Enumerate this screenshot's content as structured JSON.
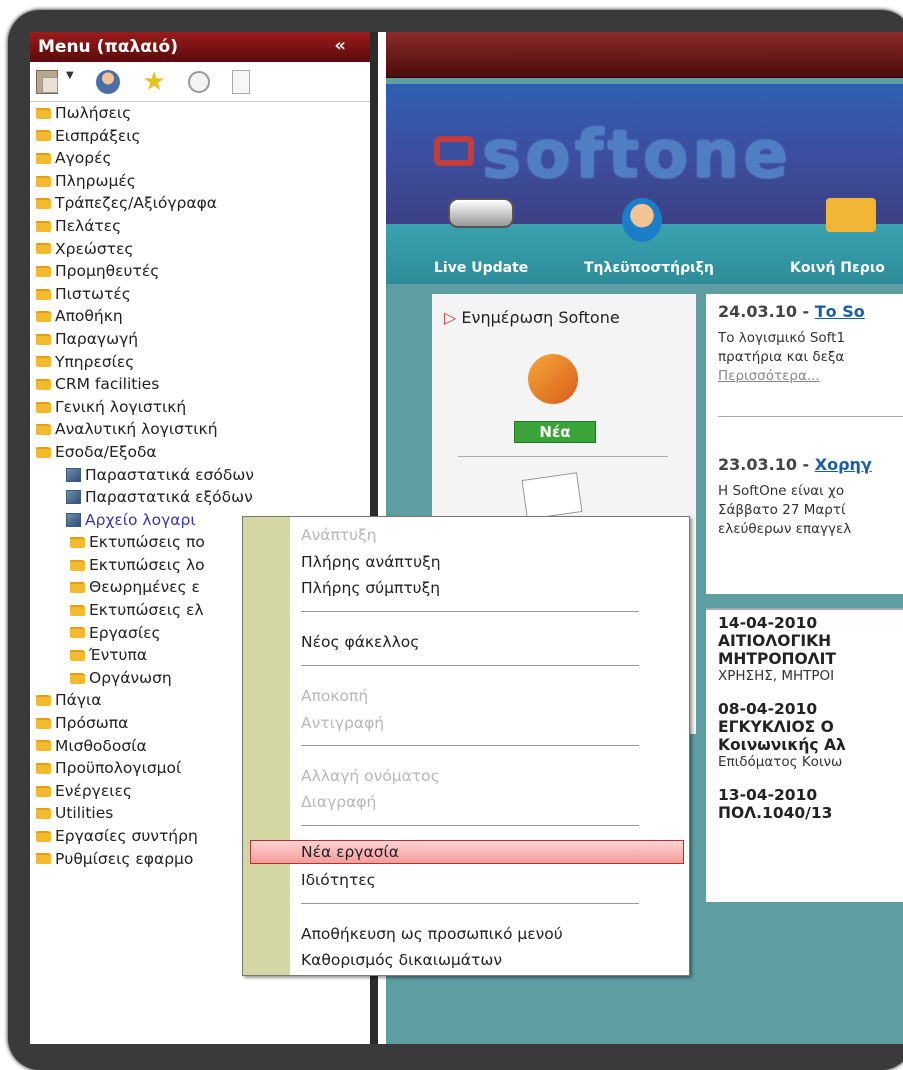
{
  "menu": {
    "title": "Menu (παλαιό)",
    "collapse_icon": "double-chevron-left",
    "tree": [
      {
        "label": "Πωλήσεις",
        "icon": "folder",
        "level": 1
      },
      {
        "label": "Εισπράξεις",
        "icon": "folder",
        "level": 1
      },
      {
        "label": "Αγορές",
        "icon": "folder",
        "level": 1
      },
      {
        "label": "Πληρωμές",
        "icon": "folder",
        "level": 1
      },
      {
        "label": "Τράπεζες/Αξιόγραφα",
        "icon": "folder",
        "level": 1
      },
      {
        "label": "Πελάτες",
        "icon": "folder",
        "level": 1
      },
      {
        "label": "Χρεώστες",
        "icon": "folder",
        "level": 1
      },
      {
        "label": "Προμηθευτές",
        "icon": "folder",
        "level": 1
      },
      {
        "label": "Πιστωτές",
        "icon": "folder",
        "level": 1
      },
      {
        "label": "Αποθήκη",
        "icon": "folder",
        "level": 1
      },
      {
        "label": "Παραγωγή",
        "icon": "folder",
        "level": 1
      },
      {
        "label": "Υπηρεσίες",
        "icon": "folder",
        "level": 1
      },
      {
        "label": "CRM facilities",
        "icon": "folder",
        "level": 1
      },
      {
        "label": "Γενική λογιστική",
        "icon": "folder",
        "level": 1
      },
      {
        "label": "Αναλυτική λογιστική",
        "icon": "folder",
        "level": 1
      },
      {
        "label": "Εσοδα/Εξοδα",
        "icon": "folder",
        "level": 1
      },
      {
        "label": "Παραστατικά εσόδων",
        "icon": "cube",
        "level": 2
      },
      {
        "label": "Παραστατικά εξόδων",
        "icon": "cube",
        "level": 2
      },
      {
        "label": "Αρχείο λογαρι",
        "icon": "cube",
        "level": 2,
        "selected": true
      },
      {
        "label": "Εκτυπώσεις πο",
        "icon": "folder",
        "level": 3
      },
      {
        "label": "Εκτυπώσεις λο",
        "icon": "folder",
        "level": 3
      },
      {
        "label": "Θεωρημένες ε",
        "icon": "folder",
        "level": 3
      },
      {
        "label": "Εκτυπώσεις ελ",
        "icon": "folder",
        "level": 3
      },
      {
        "label": "Εργασίες",
        "icon": "folder",
        "level": 3
      },
      {
        "label": "Έντυπα",
        "icon": "folder",
        "level": 3
      },
      {
        "label": "Οργάνωση",
        "icon": "folder",
        "level": 3
      },
      {
        "label": "Πάγια",
        "icon": "folder",
        "level": 1
      },
      {
        "label": "Πρόσωπα",
        "icon": "folder",
        "level": 1
      },
      {
        "label": "Μισθοδοσία",
        "icon": "folder",
        "level": 1
      },
      {
        "label": "Προϋπολογισμοί",
        "icon": "folder",
        "level": 1
      },
      {
        "label": "Ενέργειες",
        "icon": "folder",
        "level": 1
      },
      {
        "label": "Utilities",
        "icon": "folder",
        "level": 1
      },
      {
        "label": "Εργασίες συντήρη",
        "icon": "folder",
        "level": 1
      },
      {
        "label": "Ρυθμίσεις εφαρμο",
        "icon": "folder",
        "level": 1
      }
    ]
  },
  "header": {
    "logo_text": "softone",
    "nav": [
      {
        "label": "Live Update",
        "icon": "router-icon"
      },
      {
        "label": "Τηλεϋποστήριξη",
        "icon": "headset-icon"
      },
      {
        "label": "Κοινή Περιο",
        "icon": "people-icon"
      }
    ]
  },
  "news_panel": {
    "title": "Ενημέρωση Softone",
    "badge": "Νέα"
  },
  "news": [
    {
      "date": "24.03.10 - ",
      "link": "Το So",
      "line1": "Το λογισμικό Soft1",
      "line2": "πρατήρια και δεξα",
      "more": "Περισσότερα..."
    },
    {
      "date": "23.03.10 - ",
      "link": "Χορηγ",
      "line1": "Η SoftOne είναι χο",
      "line2": "Σάββατο 27 Μαρτί",
      "line3": "ελεύθερων επαγγελ"
    }
  ],
  "news2": [
    {
      "date": "14-04-2010",
      "title1": "ΑΙΤΙΟΛΟΓΙΚΗ",
      "title2": "ΜΗΤΡΟΠΟΛΙΤ",
      "text": "ΧΡΗΣΗΣ, ΜΗΤΡΟΙ"
    },
    {
      "date": "08-04-2010",
      "title1": "ΕΓΚΥΚΛΙΟΣ Ο",
      "title2": "Κοινωνικής Αλ",
      "text": "Επιδόματος Κοινω"
    },
    {
      "date": "13-04-2010",
      "title1": "ΠΟΛ.1040/13"
    }
  ],
  "context_menu": {
    "expand": "Ανάπτυξη",
    "full_expand": "Πλήρης ανάπτυξη",
    "full_collapse": "Πλήρης σύμπτυξη",
    "new_folder": "Νέος φάκελλος",
    "cut": "Αποκοπή",
    "copy": "Αντιγραφή",
    "rename": "Αλλαγή ονόματος",
    "delete": "Διαγραφή",
    "new_task": "Νέα εργασία",
    "properties": "Ιδιότητες",
    "save_personal": "Αποθήκευση ως προσωπικό μενού",
    "permissions": "Καθορισμός δικαιωμάτων"
  }
}
